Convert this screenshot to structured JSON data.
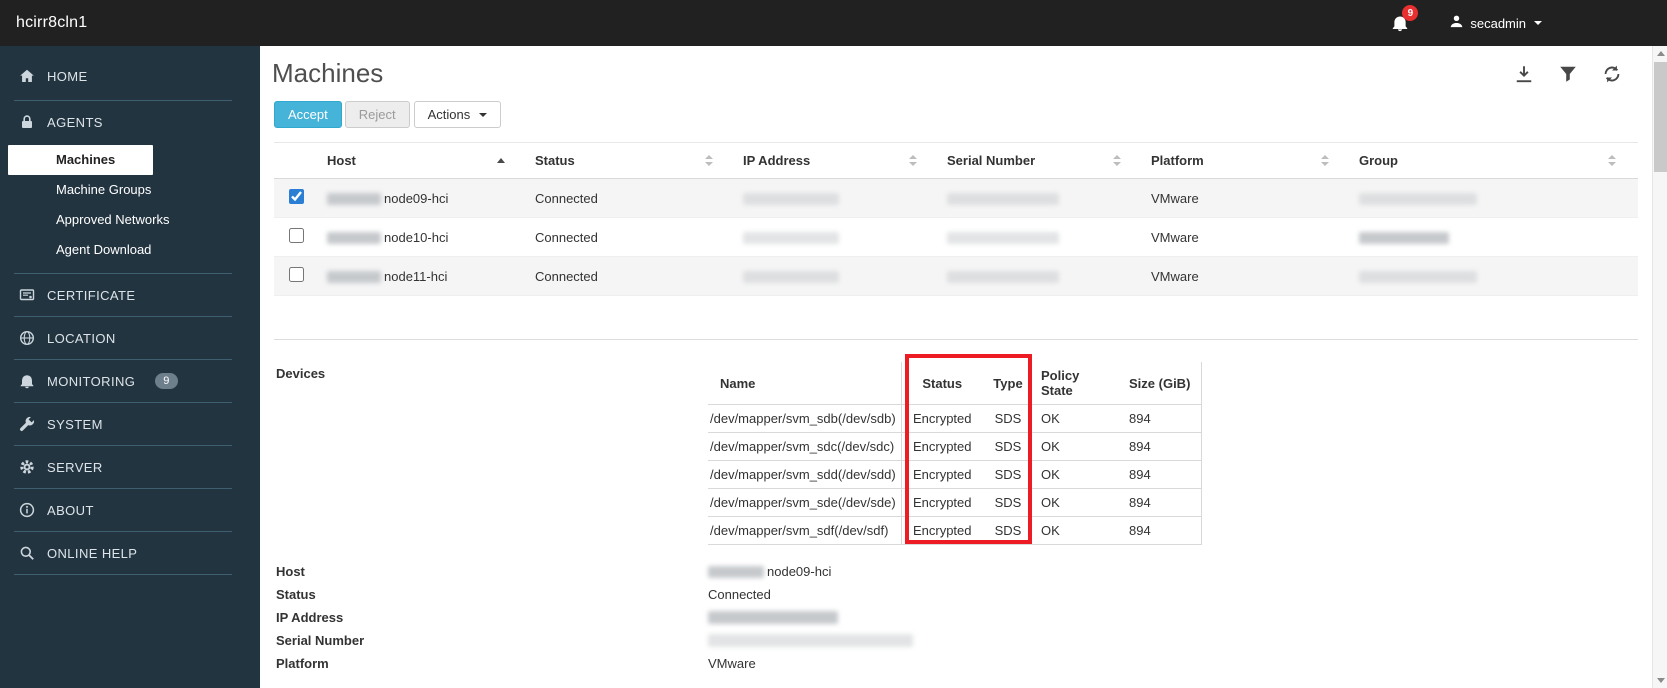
{
  "topbar": {
    "title": "hcirr8cln1",
    "notification_count": "9",
    "user_name": "secadmin"
  },
  "sidebar": {
    "items": [
      {
        "id": "home",
        "label": "HOME"
      },
      {
        "id": "agents",
        "label": "AGENTS"
      },
      {
        "id": "certificate",
        "label": "CERTIFICATE"
      },
      {
        "id": "location",
        "label": "LOCATION"
      },
      {
        "id": "monitoring",
        "label": "MONITORING",
        "badge": "9"
      },
      {
        "id": "system",
        "label": "SYSTEM"
      },
      {
        "id": "server",
        "label": "SERVER"
      },
      {
        "id": "about",
        "label": "ABOUT"
      },
      {
        "id": "online-help",
        "label": "ONLINE HELP"
      }
    ],
    "agents_submenu": [
      {
        "label": "Machines",
        "active": true
      },
      {
        "label": "Machine Groups",
        "active": false
      },
      {
        "label": "Approved Networks",
        "active": false
      },
      {
        "label": "Agent Download",
        "active": false
      }
    ]
  },
  "main": {
    "title": "Machines",
    "toolbar": {
      "accept_label": "Accept",
      "reject_label": "Reject",
      "actions_label": "Actions"
    },
    "machines_table": {
      "headers": [
        "Host",
        "Status",
        "IP Address",
        "Serial Number",
        "Platform",
        "Group"
      ],
      "sort": {
        "column": "Host",
        "direction": "asc"
      },
      "rows": [
        {
          "host": "node09-hci",
          "host_prefix_redacted": true,
          "status": "Connected",
          "ip_address": "",
          "serial_number": "",
          "platform": "VMware",
          "group": "",
          "checked": true
        },
        {
          "host": "node10-hci",
          "host_prefix_redacted": true,
          "status": "Connected",
          "ip_address": "",
          "serial_number": "",
          "platform": "VMware",
          "group": "",
          "checked": false
        },
        {
          "host": "node11-hci",
          "host_prefix_redacted": true,
          "status": "Connected",
          "ip_address": "",
          "serial_number": "",
          "platform": "VMware",
          "group": "",
          "checked": false
        }
      ]
    },
    "details": {
      "devices_label": "Devices",
      "devices_table": {
        "headers": [
          "Name",
          "Status",
          "Type",
          "Policy State",
          "Size (GiB)"
        ],
        "rows": [
          [
            "/dev/mapper/svm_sdb(/dev/sdb)",
            "Encrypted",
            "SDS",
            "OK",
            "894"
          ],
          [
            "/dev/mapper/svm_sdc(/dev/sdc)",
            "Encrypted",
            "SDS",
            "OK",
            "894"
          ],
          [
            "/dev/mapper/svm_sdd(/dev/sdd)",
            "Encrypted",
            "SDS",
            "OK",
            "894"
          ],
          [
            "/dev/mapper/svm_sde(/dev/sde)",
            "Encrypted",
            "SDS",
            "OK",
            "894"
          ],
          [
            "/dev/mapper/svm_sdf(/dev/sdf)",
            "Encrypted",
            "SDS",
            "OK",
            "894"
          ]
        ],
        "annotation": "red box highlighting Status and Type columns"
      },
      "fields": [
        {
          "label": "Host",
          "value": "node09-hci",
          "prefix_redacted": true
        },
        {
          "label": "Status",
          "value": "Connected"
        },
        {
          "label": "IP Address",
          "value": "",
          "redacted": true
        },
        {
          "label": "Serial Number",
          "value": "",
          "redacted": true
        },
        {
          "label": "Platform",
          "value": "VMware"
        }
      ]
    }
  },
  "colors": {
    "topbar_bg": "#212121",
    "sidebar_bg": "#233441",
    "sidebar_divider": "#3d5f6f",
    "accent_blue": "#46b3d9",
    "accent_blue_border": "#31a8cf",
    "annotation_red": "#ed1c24",
    "badge_red": "#e83030",
    "monitoring_badge_bg": "#6d7f8b"
  }
}
